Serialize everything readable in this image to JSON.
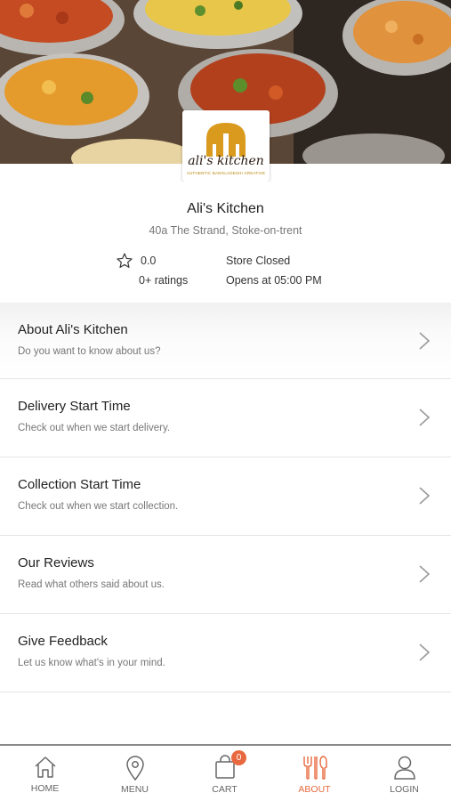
{
  "colors": {
    "accent": "#e8693f",
    "divider": "#e4e4e4",
    "gold": "#d99a1e"
  },
  "logo": {
    "text": "ali's kitchen",
    "tagline": "AUTHENTIC BANGLADESHI CREATIVE"
  },
  "store": {
    "name": "Ali's Kitchen",
    "address": "40a The Strand, Stoke-on-trent",
    "rating": "0.0",
    "ratings_count": "0+ ratings",
    "status": "Store Closed",
    "opens": "Opens at 05:00 PM"
  },
  "menu": [
    {
      "title": "About Ali's Kitchen",
      "subtitle": "Do you want to know about us?"
    },
    {
      "title": "Delivery Start Time",
      "subtitle": "Check out when we start delivery."
    },
    {
      "title": "Collection Start Time",
      "subtitle": "Check out when we start collection."
    },
    {
      "title": "Our Reviews",
      "subtitle": "Read what others said about us."
    },
    {
      "title": "Give Feedback",
      "subtitle": "Let us know what's in your mind."
    }
  ],
  "tabs": [
    {
      "label": "HOME",
      "icon": "home-icon"
    },
    {
      "label": "MENU",
      "icon": "location-pin-icon"
    },
    {
      "label": "CART",
      "icon": "shopping-bag-icon",
      "badge": "0"
    },
    {
      "label": "ABOUT",
      "icon": "cutlery-icon",
      "active": true
    },
    {
      "label": "LOGIN",
      "icon": "user-icon"
    }
  ]
}
